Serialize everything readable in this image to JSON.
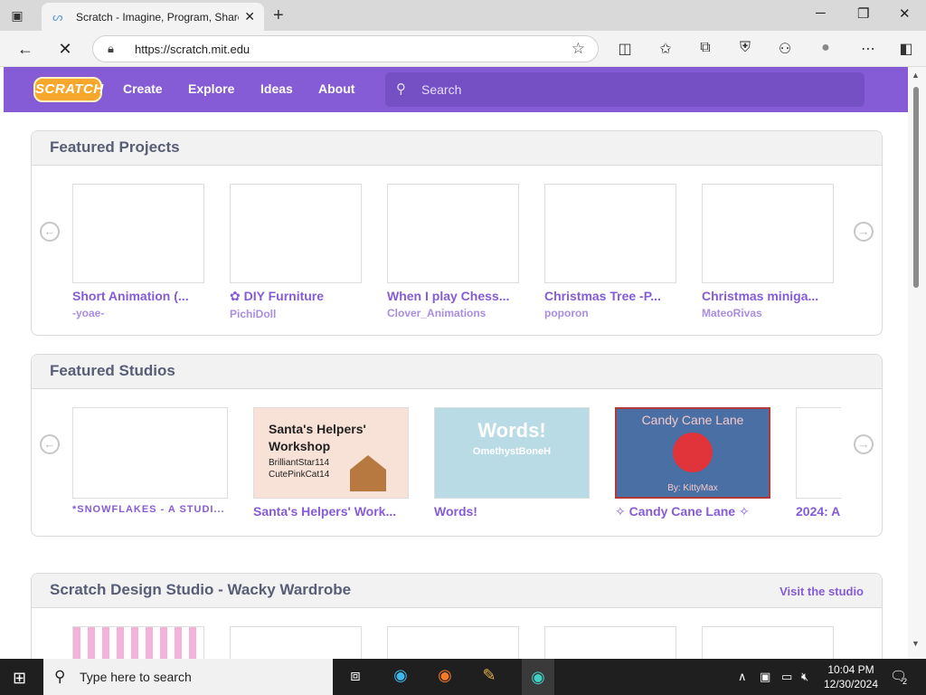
{
  "browser": {
    "tab_title": "Scratch - Imagine, Program, Share",
    "url": "https://scratch.mit.edu"
  },
  "nav": {
    "logo": "SCRATCH",
    "links": [
      "Create",
      "Explore",
      "Ideas",
      "About"
    ],
    "search_placeholder": "Search"
  },
  "featured_projects": {
    "title": "Featured Projects",
    "items": [
      {
        "title": "Short Animation (...",
        "author": "-yoae-"
      },
      {
        "title": "✿ DIY Furniture",
        "author": "PichiDoll"
      },
      {
        "title": "When I play Chess...",
        "author": "Clover_Animations"
      },
      {
        "title": "Christmas Tree -P...",
        "author": "poporon"
      },
      {
        "title": "Christmas miniga...",
        "author": "MateoRivas"
      }
    ]
  },
  "featured_studios": {
    "title": "Featured Studios",
    "items": [
      {
        "title": "*SNOWFLAKES - A STUDI..."
      },
      {
        "title": "Santa's Helpers' Work...",
        "thumb_heading": "Santa's Helpers' Workshop",
        "thumb_names": "BrilliantStar114\nCutePinkCat14"
      },
      {
        "title": "Words!",
        "thumb_heading": "Words!",
        "thumb_sub": "OmethystBoneH"
      },
      {
        "title": "✧ Candy Cane Lane ✧",
        "thumb_heading": "Candy Cane Lane",
        "thumb_sub": "By: KittyMax"
      },
      {
        "title": "2024: A"
      }
    ]
  },
  "design_studio": {
    "title": "Scratch Design Studio - Wacky Wardrobe",
    "link": "Visit the studio"
  },
  "taskbar": {
    "search_placeholder": "Type here to search",
    "time": "10:04 PM",
    "date": "12/30/2024",
    "notifications": "2"
  }
}
